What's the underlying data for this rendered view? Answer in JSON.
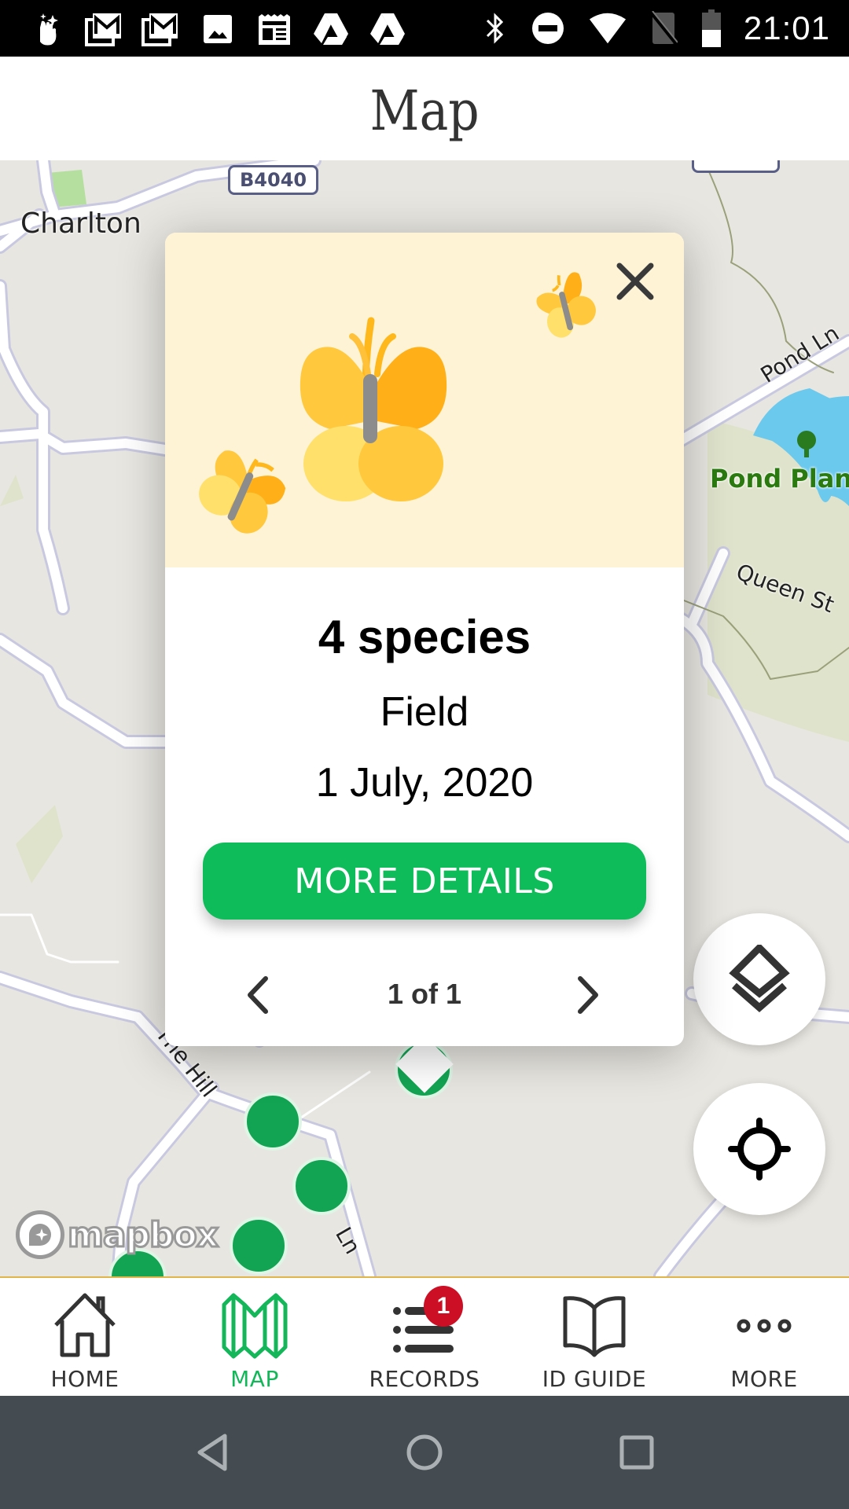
{
  "status_bar": {
    "time": "21:01",
    "left_icons": [
      "hand-sparkle-icon",
      "gmail-icon",
      "gmail-icon",
      "image-icon",
      "news-icon",
      "drive-icon",
      "drive-icon"
    ],
    "right_icons": [
      "bluetooth-icon",
      "do-not-disturb-icon",
      "wifi-icon",
      "no-signal-icon",
      "battery-icon"
    ]
  },
  "header": {
    "title": "Map"
  },
  "map": {
    "place_labels": {
      "charlton": "Charlton",
      "pond_ln": "Pond Ln",
      "pond_plantation": "Pond Planta",
      "queen_st": "Queen St",
      "the_hill": "The Hill",
      "lane_partial": "Ln"
    },
    "road_shields": {
      "b4040": "B4040"
    },
    "attribution": "mapbox",
    "marker_count": 6,
    "marker_color": "#13a453"
  },
  "popup": {
    "title": "4 species",
    "habitat": "Field",
    "date": "1 July, 2020",
    "more_details_label": "MORE DETAILS",
    "pager": {
      "current": 1,
      "total": 1,
      "label": "1 of 1"
    },
    "image_bg": "#fff3d6"
  },
  "controls": {
    "layers": "layers-icon",
    "locate": "locate-icon"
  },
  "bottom_nav": {
    "items": [
      {
        "label": "HOME",
        "icon": "home-icon",
        "active": false
      },
      {
        "label": "MAP",
        "icon": "map-icon",
        "active": true
      },
      {
        "label": "RECORDS",
        "icon": "list-icon",
        "active": false,
        "badge": "1"
      },
      {
        "label": "ID GUIDE",
        "icon": "book-icon",
        "active": false
      },
      {
        "label": "MORE",
        "icon": "more-icon",
        "active": false
      }
    ],
    "active_color": "#14b65a",
    "badge_color": "#cc0f24"
  },
  "android_nav": {
    "buttons": [
      "back",
      "home",
      "recents"
    ]
  }
}
